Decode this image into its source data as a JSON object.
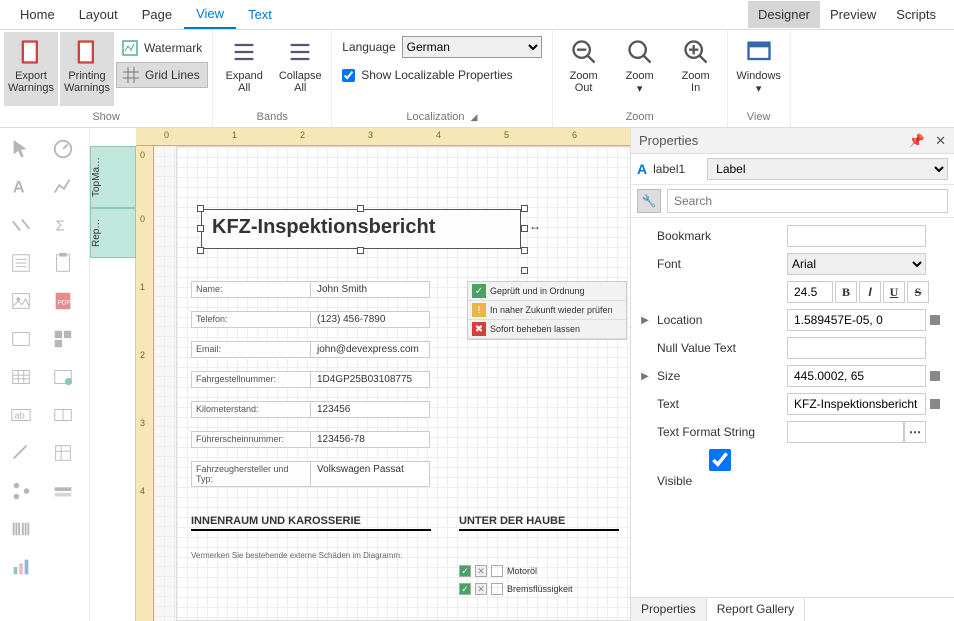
{
  "menu": {
    "items": [
      "Home",
      "Layout",
      "Page",
      "View",
      "Text"
    ],
    "active": "View",
    "modes": [
      "Designer",
      "Preview",
      "Scripts"
    ],
    "mode_active": "Designer"
  },
  "ribbon": {
    "show": {
      "label": "Show",
      "export_warnings": "Export\nWarnings",
      "printing_warnings": "Printing\nWarnings",
      "watermark": "Watermark",
      "grid_lines": "Grid Lines"
    },
    "bands": {
      "label": "Bands",
      "expand": "Expand\nAll",
      "collapse": "Collapse\nAll"
    },
    "localization": {
      "label": "Localization",
      "language_label": "Language",
      "language_value": "German",
      "show_loc": "Show Localizable Properties"
    },
    "zoom": {
      "label": "Zoom",
      "out": "Zoom\nOut",
      "zoom": "Zoom",
      "in": "Zoom\nIn"
    },
    "view": {
      "label": "View",
      "windows": "Windows"
    }
  },
  "bands": {
    "top_margin": "TopMa…",
    "report_header": "Rep…"
  },
  "ruler_h": [
    "0",
    "1",
    "2",
    "3",
    "4",
    "5",
    "6"
  ],
  "ruler_v": [
    "0",
    "0",
    "1",
    "2",
    "3",
    "4"
  ],
  "report": {
    "title": "KFZ-Inspektionsbericht",
    "fields": [
      {
        "label": "Name:",
        "value": "John Smith"
      },
      {
        "label": "Telefon:",
        "value": "(123) 456-7890"
      },
      {
        "label": "Email:",
        "value": "john@devexpress.com"
      },
      {
        "label": "Fahrgestellnummer:",
        "value": "1D4GP25B03108775"
      },
      {
        "label": "Kilometerstand:",
        "value": "123456"
      },
      {
        "label": "Führerscheinnummer:",
        "value": "123456-78"
      },
      {
        "label": "Fahrzeughersteller und Typ:",
        "value": "Volkswagen Passat"
      }
    ],
    "legend": [
      {
        "color": "#4aa264",
        "text": "Geprüft und in Ordnung"
      },
      {
        "color": "#e8b548",
        "text": "In naher Zukunft wieder prüfen"
      },
      {
        "color": "#d24038",
        "text": "Sofort beheben lassen"
      }
    ],
    "section_left": "INNENRAUM UND KAROSSERIE",
    "section_right": "UNTER DER HAUBE",
    "note": "Vermerken Sie bestehende externe Schäden im Diagramm:",
    "check_items": [
      "Motoröl",
      "Bremsflüssigkeit"
    ]
  },
  "properties": {
    "title": "Properties",
    "object_name": "label1",
    "object_type": "Label",
    "search_placeholder": "Search",
    "rows": {
      "bookmark": {
        "label": "Bookmark",
        "value": ""
      },
      "font": {
        "label": "Font",
        "value": "Arial",
        "size": "24.5"
      },
      "location": {
        "label": "Location",
        "value": "1.589457E-05, 0"
      },
      "null_text": {
        "label": "Null Value Text",
        "value": ""
      },
      "size": {
        "label": "Size",
        "value": "445.0002, 65"
      },
      "text": {
        "label": "Text",
        "value": "KFZ-Inspektionsbericht"
      },
      "fmt": {
        "label": "Text Format String",
        "value": ""
      },
      "visible": {
        "label": "Visible"
      }
    },
    "tabs": [
      "Properties",
      "Report Gallery"
    ]
  }
}
